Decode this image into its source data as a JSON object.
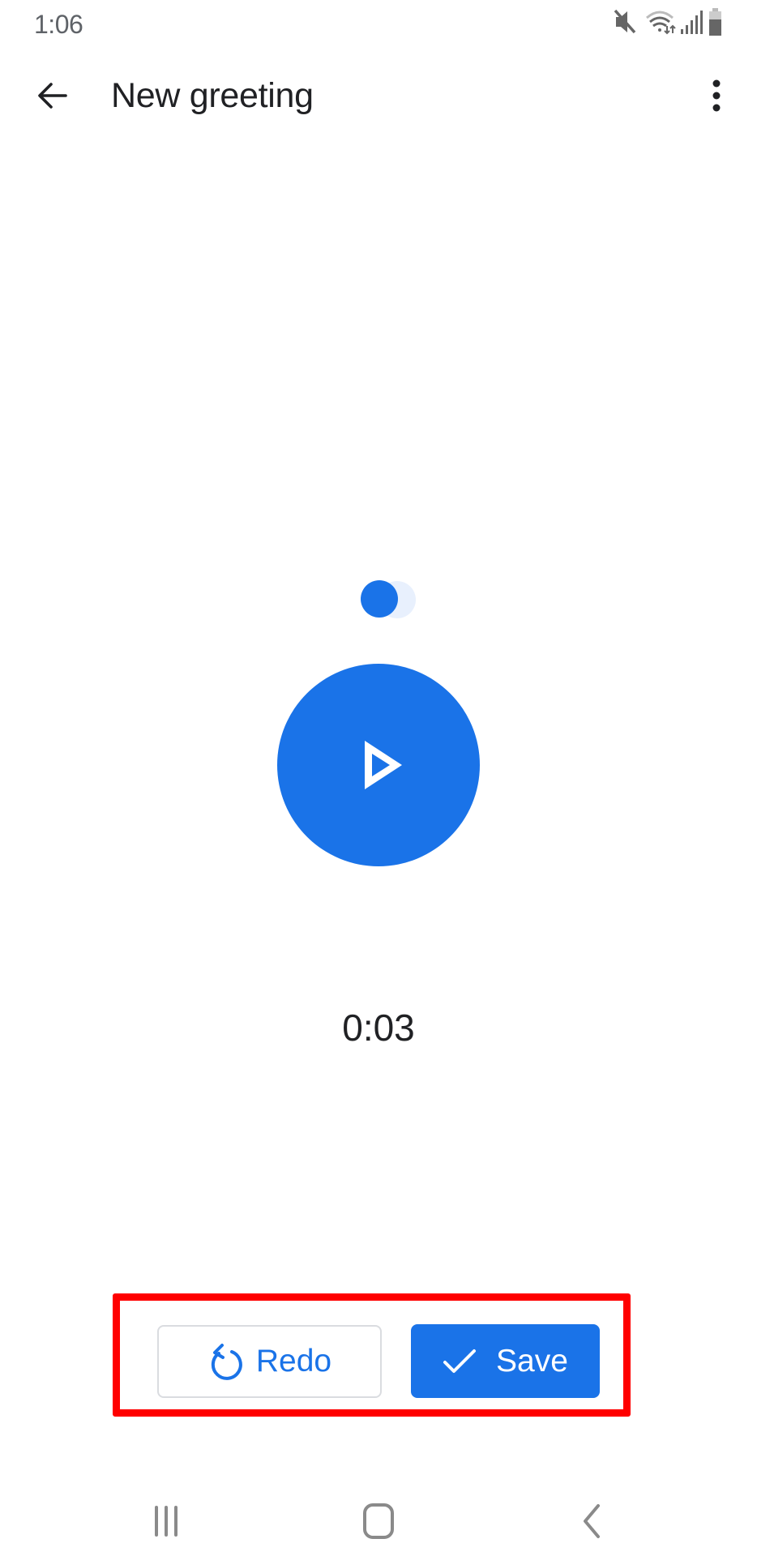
{
  "status_bar": {
    "time": "1:06",
    "icons": [
      "mute-icon",
      "wifi-icon",
      "signal-icon",
      "battery-icon"
    ]
  },
  "app_bar": {
    "back_icon": "arrow-back-icon",
    "title": "New greeting",
    "menu_icon": "more-vert-icon"
  },
  "player": {
    "indicator_icon": "recording-progress-indicator",
    "play_icon": "play-icon",
    "elapsed": "0:03"
  },
  "actions": {
    "redo": {
      "label": "Redo",
      "icon": "redo-icon"
    },
    "save": {
      "label": "Save",
      "icon": "check-icon"
    }
  },
  "nav_bar": {
    "recents_icon": "recents-icon",
    "home_icon": "home-icon",
    "back_icon": "nav-back-icon"
  },
  "colors": {
    "accent": "#1a73e8",
    "accent_light": "#e8f0fd",
    "highlight": "#ff0000",
    "text_primary": "#202124",
    "text_secondary": "#5f6368"
  }
}
